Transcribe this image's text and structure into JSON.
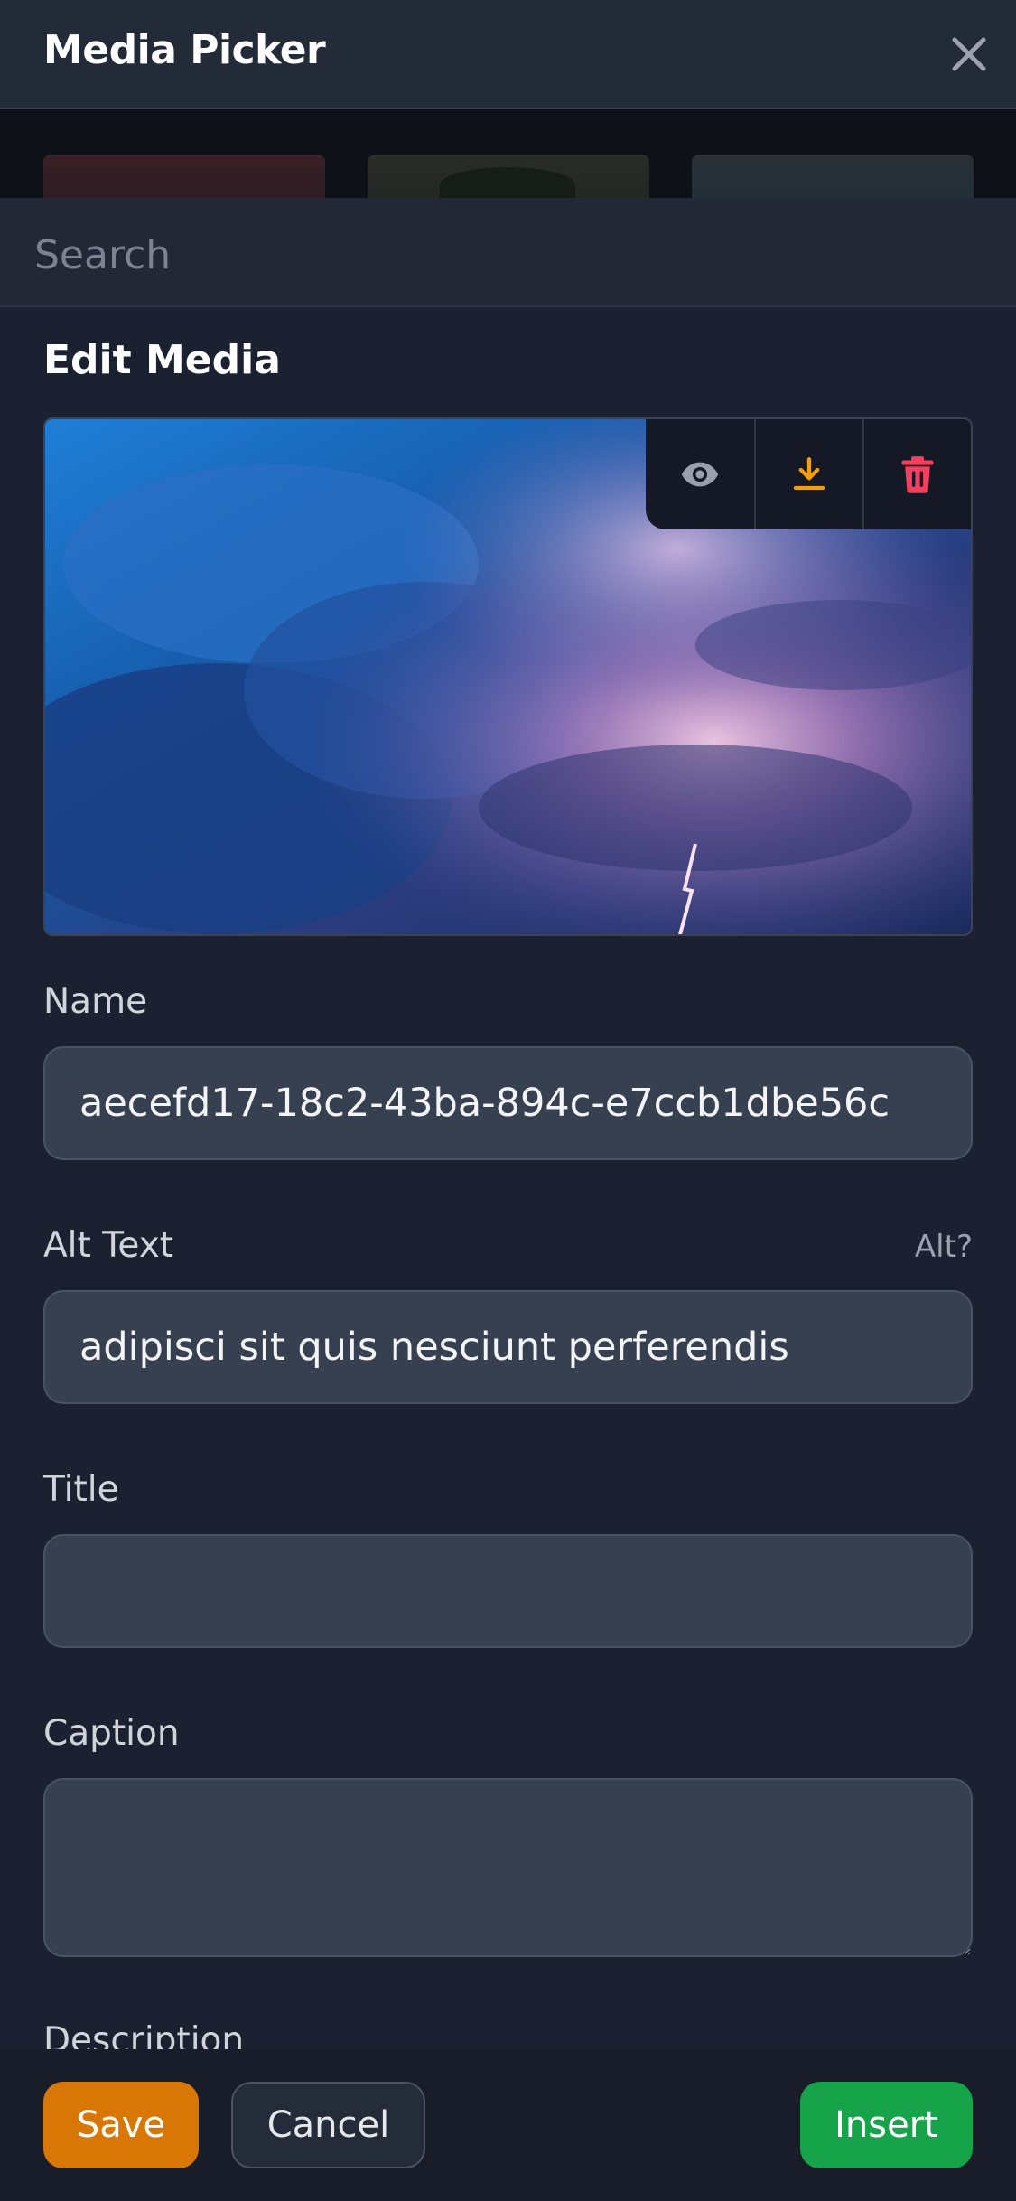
{
  "header": {
    "title": "Media Picker",
    "close_icon": "close-icon"
  },
  "search": {
    "placeholder": "Search",
    "value": ""
  },
  "edit": {
    "section_title": "Edit Media",
    "preview": {
      "description_icon_names": [
        "eye-icon",
        "download-icon",
        "trash-icon"
      ],
      "colors": {
        "view": "#9aa0ab",
        "download": "#f59e0b",
        "delete": "#f43f5e"
      }
    },
    "fields": {
      "name": {
        "label": "Name",
        "value": "aecefd17-18c2-43ba-894c-e7ccb1dbe56c"
      },
      "alt_text": {
        "label": "Alt Text",
        "aside": "Alt?",
        "value": "adipisci sit quis nesciunt perferendis"
      },
      "title": {
        "label": "Title",
        "value": ""
      },
      "caption": {
        "label": "Caption",
        "value": ""
      },
      "description": {
        "label": "Description"
      }
    }
  },
  "footer": {
    "save_label": "Save",
    "cancel_label": "Cancel",
    "insert_label": "Insert",
    "colors": {
      "save": "#d97706",
      "insert": "#16a34a"
    }
  }
}
